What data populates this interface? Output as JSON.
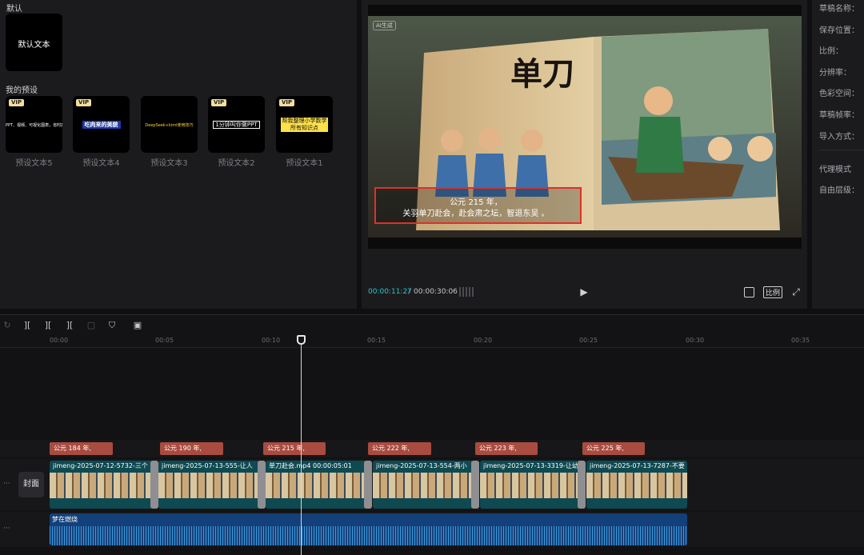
{
  "left_panel": {
    "default_section_label": "默认",
    "default_card_text": "默认文本",
    "my_presets_label": "我的预设",
    "vip_badge": "VIP",
    "presets": [
      {
        "name": "预设文本5",
        "sample": "PPT、视频、可视化图表，省时高效",
        "sample_color": "#ffffff"
      },
      {
        "name": "预设文本4",
        "sample": "吃肉来的美貌",
        "sample_color": "#ffffff"
      },
      {
        "name": "预设文本3",
        "sample": "DeepSeek+kimi使用技巧",
        "sample_color": "#ffd23a"
      },
      {
        "name": "预设文本2",
        "sample": "1分钟叫你做PPT",
        "sample_color": "#ffffff"
      },
      {
        "name": "预设文本1",
        "sample": "帮我整理小学数学所有知识点",
        "sample_color": "#111111"
      }
    ]
  },
  "preview": {
    "ai_badge": "AI生成",
    "book_title": "单刀",
    "subtitle_line1": "公元 215 年，",
    "subtitle_line2": "关羽单刀赴会，赴会肃之坛，智退东吴 。",
    "current_time": "00:00:11:27",
    "total_time": "00:00:30:06",
    "ratio_label": "比例",
    "highlight_color": "#e0302a"
  },
  "properties": {
    "labels": [
      "草稿名称：",
      "保存位置：",
      "比例：",
      "分辨率：",
      "色彩空间：",
      "草稿帧率：",
      "导入方式："
    ],
    "labels2": [
      "代理模式",
      "自由层级："
    ]
  },
  "timeline": {
    "ruler_ticks": [
      "00:00",
      "00:05",
      "00:10",
      "00:15",
      "00:20",
      "00:25",
      "00:30",
      "00:35"
    ],
    "subtitles": [
      "公元 184 年,",
      "公元 190 年,",
      "公元 215 年,",
      "公元 222 年,",
      "公元 223 年,",
      "公元 225 年,"
    ],
    "cover_label": "封面",
    "video_clips": [
      "jimeng-2025-07-12-5732-三个",
      "jimeng-2025-07-13-555-让人",
      "单刀赴会.mp4   00:00:05:01",
      "jimeng-2025-07-13-554-两小",
      "jimeng-2025-07-13-3319-让幼",
      "jimeng-2025-07-13-7287-不要"
    ],
    "audio_clip": "梦在燃烧",
    "track_more": "···"
  }
}
